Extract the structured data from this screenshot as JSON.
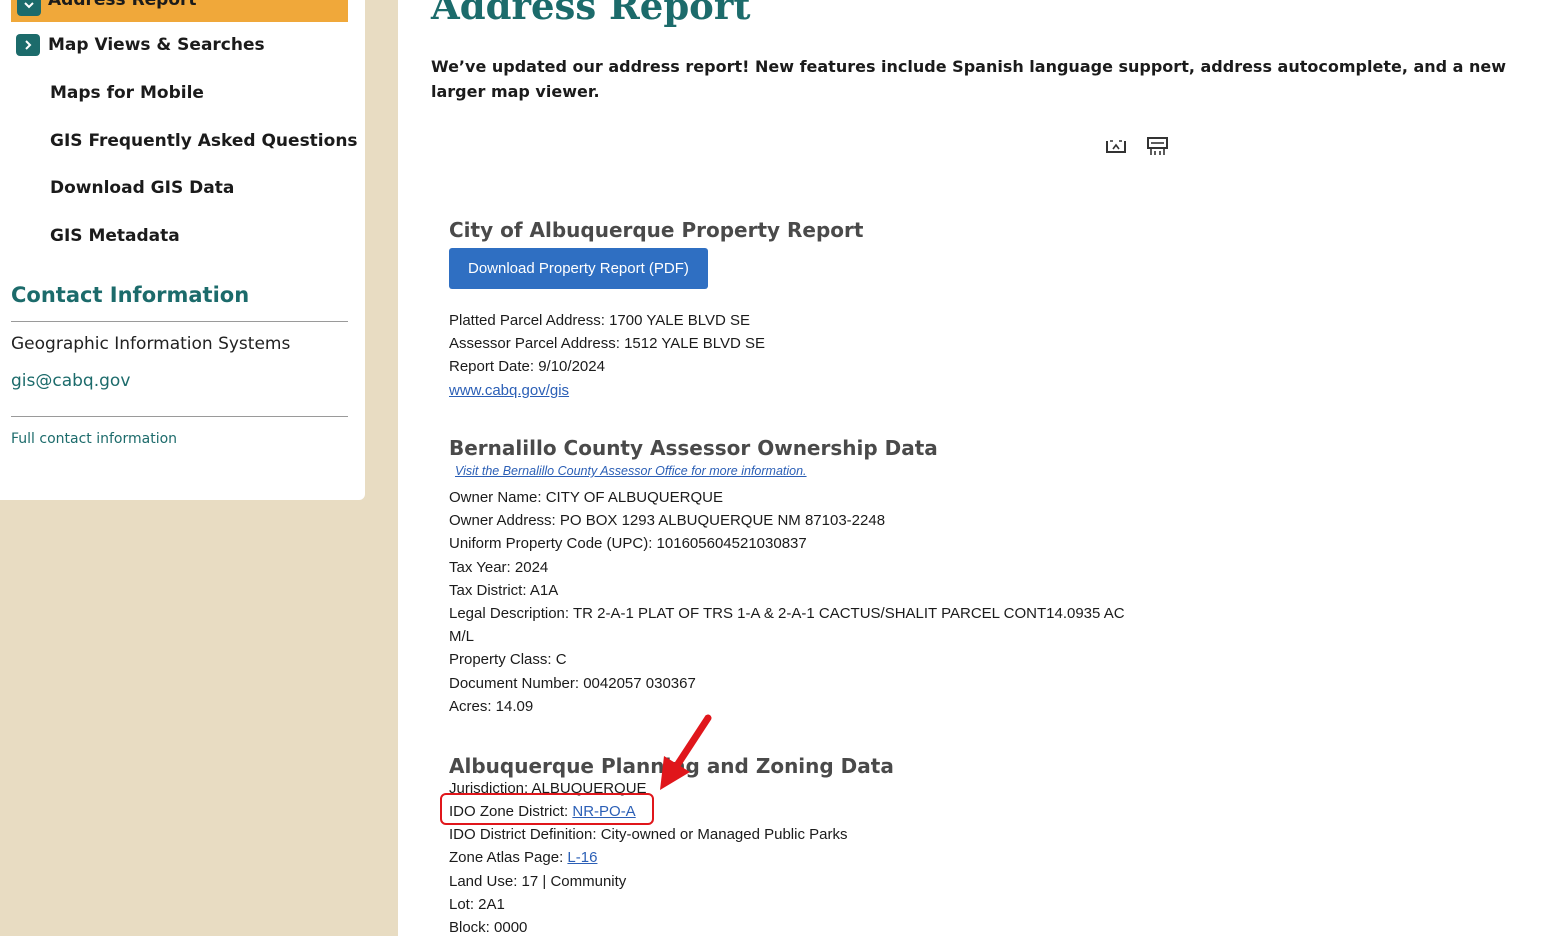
{
  "sidebar": {
    "active_item": "Address Report",
    "items": [
      {
        "label": "Map Views & Searches",
        "icon": "chevron-right-icon"
      },
      {
        "label": "Maps for Mobile"
      },
      {
        "label": "GIS Frequently Asked Questions"
      },
      {
        "label": "Download GIS Data"
      },
      {
        "label": "GIS Metadata"
      }
    ],
    "contact": {
      "title": "Contact Information",
      "org": "Geographic Information Systems",
      "email": "gis@cabq.gov",
      "full_link": "Full contact information"
    }
  },
  "main": {
    "title": "Address Report",
    "intro": "We’ve updated our address report! New features include Spanish language support, address autocomplete, and a new larger map viewer.",
    "tools": [
      "fullscreen-icon",
      "print-icon"
    ],
    "property_report": {
      "heading": "City of Albuquerque Property Report",
      "button": "Download Property Report (PDF)",
      "platted_address": "Platted Parcel Address: 1700 YALE BLVD SE",
      "assessor_address": "Assessor Parcel Address: 1512 YALE BLVD SE",
      "report_date": "Report Date: 9/10/2024",
      "link": "www.cabq.gov/gis"
    },
    "assessor": {
      "heading": "Bernalillo County Assessor Ownership Data",
      "link": "Visit the Bernalillo County Assessor Office for more information.",
      "fields": [
        "Owner Name: CITY OF ALBUQUERQUE",
        "Owner Address: PO BOX 1293 ALBUQUERQUE NM 87103-2248",
        "Uniform Property Code (UPC): 101605604521030837",
        "Tax Year: 2024",
        "Tax District: A1A",
        "Legal Description: TR 2-A-1 PLAT OF TRS 1-A & 2-A-1 CACTUS/SHALIT PARCEL CONT14.0935 AC M/L",
        "Property Class: C",
        "Document Number: 0042057 030367",
        "Acres: 14.09"
      ]
    },
    "planning": {
      "heading": "Albuquerque Planning and Zoning Data",
      "jurisdiction": "Jurisdiction: ALBUQUERQUE",
      "zone_label": "IDO Zone District: ",
      "zone_value": "NR-PO-A",
      "definition": "IDO District Definition: City-owned or Managed Public Parks",
      "atlas_label": "Zone Atlas Page: ",
      "atlas_value": "L-16",
      "land_use": "Land Use: 17 | Community",
      "lot": "Lot: 2A1",
      "block": "Block: 0000"
    }
  },
  "annotation": {
    "color": "#e0161b"
  }
}
